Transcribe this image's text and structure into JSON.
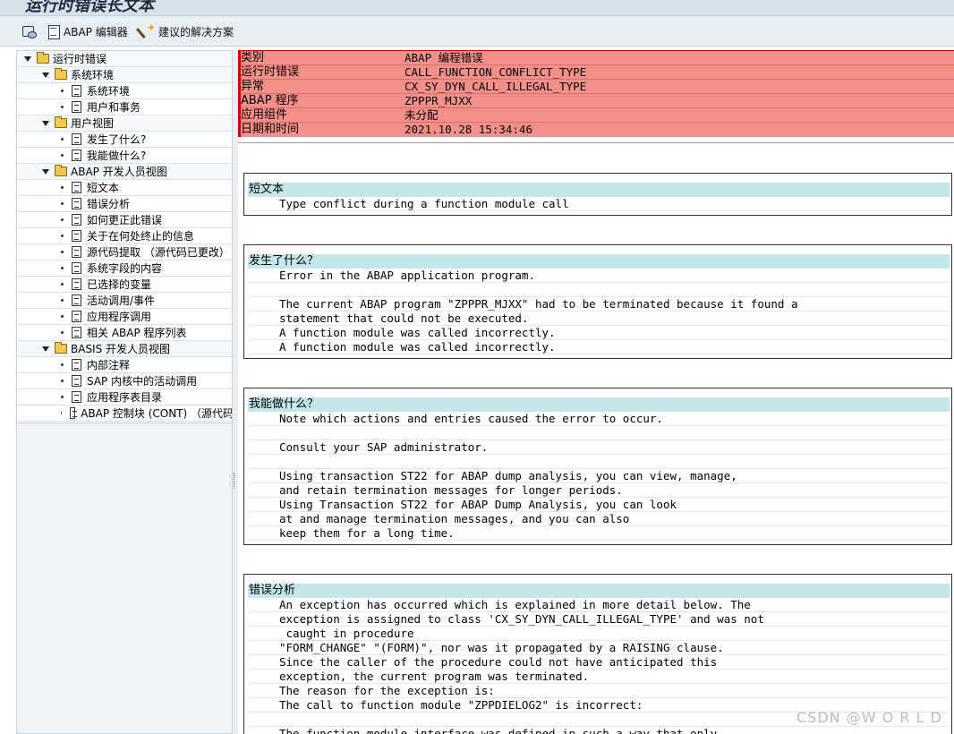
{
  "window": {
    "title": "运行时错误长文本"
  },
  "toolbar": {
    "abap_editor_label": "ABAP 编辑器",
    "suggested_solution_label": "建议的解决方案"
  },
  "tree": {
    "root": "运行时错误",
    "groups": [
      {
        "label": "系统环境",
        "items": [
          "系统环境",
          "用户和事务"
        ]
      },
      {
        "label": "用户视图",
        "items": [
          "发生了什么?",
          "我能做什么?"
        ]
      },
      {
        "label": "ABAP 开发人员视图",
        "items": [
          "短文本",
          "错误分析",
          "如何更正此错误",
          "关于在何处终止的信息",
          "源代码提取 （源代码已更改）",
          "系统字段的内容",
          "已选择的变量",
          "活动调用/事件",
          "应用程序调用",
          "相关 ABAP 程序列表"
        ]
      },
      {
        "label": "BASIS 开发人员视图",
        "items": [
          "内部注释",
          "SAP 内核中的活动调用",
          "应用程序表目录",
          "ABAP 控制块 (CONT) （源代码"
        ]
      }
    ]
  },
  "header": {
    "rows": [
      {
        "key": "类别",
        "value": "ABAP 编程错误"
      },
      {
        "key": "运行时错误",
        "value": "CALL_FUNCTION_CONFLICT_TYPE"
      },
      {
        "key": "异常",
        "value": "CX_SY_DYN_CALL_ILLEGAL_TYPE"
      },
      {
        "key": "ABAP 程序",
        "value": "ZPPPR_MJXX"
      },
      {
        "key": "应用组件",
        "value": "未分配"
      },
      {
        "key": "日期和时间",
        "value": "2021.10.28 15:34:46"
      }
    ]
  },
  "sections": [
    {
      "title": "短文本",
      "lines": [
        "Type conflict during a function module call"
      ]
    },
    {
      "title": "发生了什么？",
      "lines": [
        "Error in the ABAP application program.",
        "",
        "The current ABAP program \"ZPPPR_MJXX\" had to be terminated because it found a",
        "statement that could not be executed.",
        "A function module was called incorrectly.",
        "A function module was called incorrectly."
      ]
    },
    {
      "title": "我能做什么？",
      "lines": [
        "Note which actions and entries caused the error to occur.",
        "",
        "Consult your SAP administrator.",
        "",
        "Using transaction ST22 for ABAP dump analysis, you can view, manage,",
        "and retain termination messages for longer periods.",
        "Using Transaction ST22 for ABAP Dump Analysis, you can look",
        "at and manage termination messages, and you can also",
        "keep them for a long time."
      ]
    },
    {
      "title": "错误分析",
      "lines": [
        "An exception has occurred which is explained in more detail below. The",
        "exception is assigned to class 'CX_SY_DYN_CALL_ILLEGAL_TYPE' and was not",
        " caught in procedure",
        "\"FORM_CHANGE\" \"(FORM)\", nor was it propagated by a RAISING clause.",
        "Since the caller of the procedure could not have anticipated this",
        "exception, the current program was terminated.",
        "The reason for the exception is:",
        "The call to function module \"ZPPDIELOG2\" is incorrect:",
        "",
        "The function module interface was defined in such a way that only"
      ]
    }
  ],
  "watermark": "CSDN @W O R L D"
}
